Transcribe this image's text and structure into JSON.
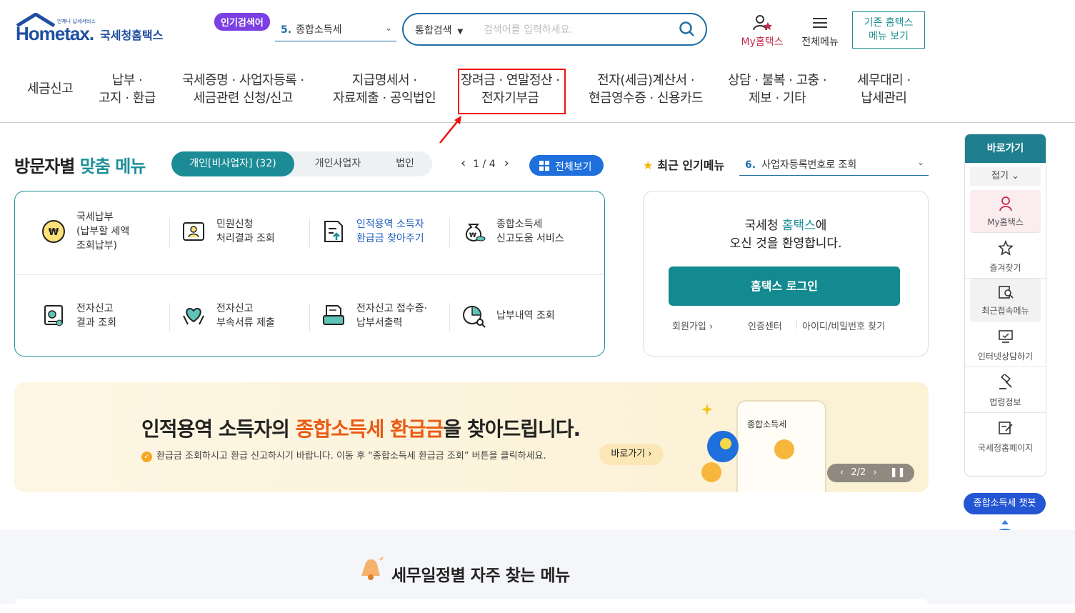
{
  "header": {
    "logo_brand": "Hometax.",
    "logo_tagline": "국세청홈택스",
    "logo_tiny": "언제나 납세서비스",
    "popular_badge": "인기검색어",
    "popular_select": {
      "num": "5.",
      "value": "종합소득세"
    },
    "search": {
      "category": "통합검색",
      "placeholder": "검색어를 입력하세요."
    },
    "my_label": "My홈택스",
    "all_menu_label": "전체메뉴",
    "old_hometax_label_1": "기존 홈택스",
    "old_hometax_label_2": "메뉴 보기"
  },
  "nav": [
    {
      "line1": "세금신고",
      "line2": ""
    },
    {
      "line1": "납부 ·",
      "line2": "고지 · 환급"
    },
    {
      "line1": "국세증명 · 사업자등록 ·",
      "line2": "세금관련 신청/신고"
    },
    {
      "line1": "지급명세서 ·",
      "line2": "자료제출 · 공익법인"
    },
    {
      "line1": "장려금 · 연말정산 ·",
      "line2": "전자기부금"
    },
    {
      "line1": "전자(세금)계산서 ·",
      "line2": "현금영수증 · 신용카드"
    },
    {
      "line1": "상담 · 불복 · 고충 ·",
      "line2": "제보 · 기타"
    },
    {
      "line1": "세무대리 ·",
      "line2": "납세관리"
    }
  ],
  "visitor": {
    "title_a": "방문자별",
    "title_b": "맞춤 메뉴",
    "tabs": [
      "개인[비사업자] (32)",
      "개인사업자",
      "법인"
    ],
    "pager": "1 / 4",
    "all_view": "전체보기",
    "items": [
      {
        "label": "국세납부\n(납부할 세액\n조회납부)",
        "icon": "won-coin-icon"
      },
      {
        "label": "민원신청\n처리결과 조회",
        "icon": "document-person-icon"
      },
      {
        "label": "인적용역 소득자\n환급금 찾아주기",
        "icon": "refund-document-icon"
      },
      {
        "label": "종합소득세\n신고도움 서비스",
        "icon": "money-bag-icon"
      },
      {
        "label": "전자신고\n결과 조회",
        "icon": "report-search-icon"
      },
      {
        "label": "전자신고\n부속서류 제출",
        "icon": "heart-hands-icon"
      },
      {
        "label": "전자신고 접수증·\n납부서출력",
        "icon": "printer-icon"
      },
      {
        "label": "납부내역 조회",
        "icon": "pie-search-icon"
      }
    ]
  },
  "popular": {
    "title": "최근 인기메뉴",
    "select_num": "6.",
    "select_value": "사업자등록번호로 조회"
  },
  "login": {
    "welcome_a": "국세청 ",
    "welcome_hl": "홈택스",
    "welcome_b": "에",
    "welcome_2": "오신 것을 환영합니다.",
    "button": "홈택스 로그인",
    "links": [
      "회원가입",
      "인증센터",
      "아이디/비밀번호 찾기"
    ]
  },
  "banner": {
    "title_a": "인적용역 소득자의 ",
    "title_hl": "종합소득세 환급금",
    "title_b": "을 찾아드립니다.",
    "sub": "환급금 조회하시고 환급 신고하시기 바랍니다. 이동 후 “종합소득세 환급금 조회” 버튼을 클릭하세요.",
    "go": "바로가기",
    "card_label": "종합소득세",
    "pager": "2/2"
  },
  "quick": {
    "header": "바로가기",
    "fold": "접기",
    "items": [
      {
        "label": "My홈택스",
        "icon": "person-icon"
      },
      {
        "label": "즐겨찾기",
        "icon": "star-icon"
      },
      {
        "label": "최근접속메뉴",
        "icon": "recent-search-icon"
      },
      {
        "label": "인터넷상담하기",
        "icon": "monitor-icon"
      },
      {
        "label": "법령정보",
        "icon": "gavel-icon"
      },
      {
        "label": "국세청홈페이지",
        "icon": "edit-page-icon"
      }
    ],
    "chatbot": "종합소득세 챗봇"
  },
  "bottom": {
    "title": "세무일정별 자주 찾는 메뉴"
  },
  "colors": {
    "teal": "#138a8f",
    "blue": "#1f6fa5",
    "red_box": "#ee1111",
    "orange": "#e85b15"
  }
}
